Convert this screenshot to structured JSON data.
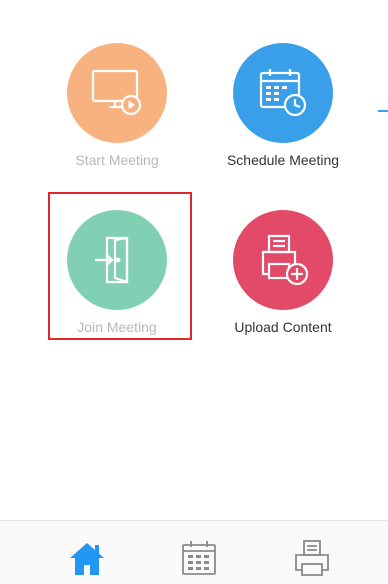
{
  "tiles": {
    "start_meeting": {
      "label": "Start Meeting",
      "icon": "monitor-play-icon",
      "color": "#f7b27f",
      "enabled": false
    },
    "schedule_meeting": {
      "label": "Schedule Meeting",
      "icon": "calendar-clock-icon",
      "color": "#3a9fe9",
      "enabled": true
    },
    "join_meeting": {
      "label": "Join Meeting",
      "icon": "door-enter-icon",
      "color": "#82d0b3",
      "enabled": false,
      "highlighted": true
    },
    "upload_content": {
      "label": "Upload Content",
      "icon": "printer-add-icon",
      "color": "#e24a68",
      "enabled": true
    }
  },
  "highlight_color": "#e3262a",
  "tabbar": {
    "items": [
      {
        "icon": "home-icon",
        "active": true,
        "color": "#2196f3"
      },
      {
        "icon": "calendar-icon",
        "active": false,
        "color": "#8a8a8a"
      },
      {
        "icon": "printer-icon",
        "active": false,
        "color": "#8a8a8a"
      }
    ]
  }
}
